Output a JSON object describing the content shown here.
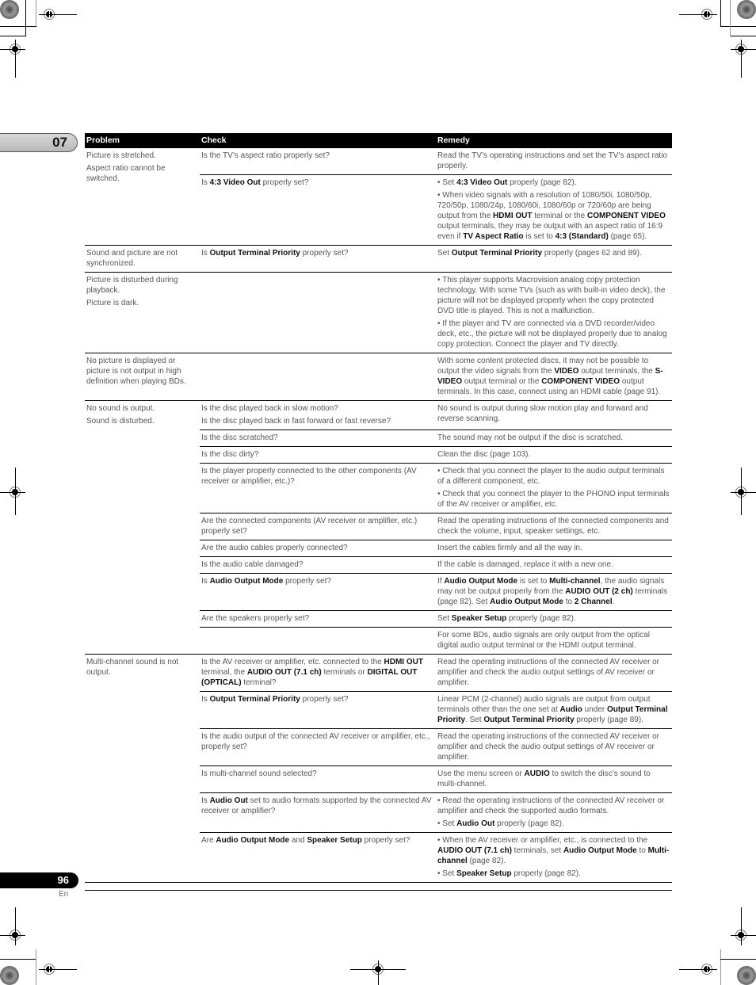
{
  "chapter": "07",
  "page_number": "96",
  "language": "En",
  "table": {
    "headers": {
      "problem": "Problem",
      "check": "Check",
      "remedy": "Remedy"
    },
    "groups": [
      {
        "problem": [
          "Picture is stretched.",
          "Aspect ratio cannot be switched."
        ],
        "rows": [
          {
            "check": [
              "Is the TV’s aspect ratio properly set?"
            ],
            "remedy": [
              "Read the TV’s operating instructions and set the TV’s aspect ratio properly."
            ]
          },
          {
            "check": [
              "Is <b>4:3 Video Out</b> properly set?"
            ],
            "remedy": [
              "• Set <b>4:3 Video Out</b> properly (page 82).",
              "• When video signals with a resolution of 1080/50i, 1080/50p, 720/50p, 1080/24p, 1080/60i, 1080/60p or 720/60p are being output from the <b>HDMI OUT</b> terminal or the <b>COMPONENT VIDEO</b> output terminals, they may be output with an aspect ratio of 16:9 even if <b>TV Aspect Ratio</b> is set to <b>4:3 (Standard)</b> (page 65)."
            ]
          }
        ]
      },
      {
        "problem": [
          "Sound and picture are not synchronized."
        ],
        "rows": [
          {
            "check": [
              "Is <b>Output Terminal Priority</b> properly set?"
            ],
            "remedy": [
              "Set <b>Output Terminal Priority</b> properly (pages 62 and 89)."
            ]
          }
        ]
      },
      {
        "problem": [
          "Picture is disturbed during playback.",
          "Picture is dark."
        ],
        "rows": [
          {
            "check": [],
            "remedy": [
              "• This player supports Macrovision analog copy protection technology. With some TVs (such as with built-in video deck), the picture will not be displayed properly when the copy protected DVD title is played. This is not a malfunction.",
              "• If the player and TV are connected via a DVD recorder/video deck, etc., the picture will not be displayed properly due to analog copy protection. Connect the player and TV directly."
            ]
          }
        ]
      },
      {
        "problem": [
          "No picture is displayed or picture is not output in high definition when playing BDs."
        ],
        "rows": [
          {
            "check": [],
            "remedy": [
              "With some content protected discs, it may not be possible to output the video signals from the <b>VIDEO</b> output terminals, the <b>S-VIDEO</b> output terminal or the <b>COMPONENT VIDEO</b> output terminals. In this case, connect using an HDMI cable (page 91)."
            ]
          }
        ]
      },
      {
        "problem": [
          "No sound is output.",
          "Sound is disturbed."
        ],
        "rows": [
          {
            "check": [
              "Is the disc played back in slow motion?",
              "Is the disc played back in fast forward or fast reverse?"
            ],
            "remedy": [
              "No sound is output during slow motion play and forward and reverse scanning."
            ]
          },
          {
            "check": [
              "Is the disc scratched?"
            ],
            "remedy": [
              "The sound may not be output if the disc is scratched."
            ]
          },
          {
            "check": [
              "Is the disc dirty?"
            ],
            "remedy": [
              "Clean the disc (page 103)."
            ]
          },
          {
            "check": [
              "Is the player properly connected to the other components (AV receiver or amplifier, etc.)?"
            ],
            "remedy": [
              "• Check that you connect the player to the audio output terminals of a different component, etc.",
              "• Check that you connect the player to the PHONO input terminals of the AV receiver or amplifier, etc."
            ]
          },
          {
            "check": [
              "Are the connected components (AV receiver or amplifier, etc.) properly set?"
            ],
            "remedy": [
              "Read the operating instructions of the connected components and check the volume, input, speaker settings, etc."
            ]
          },
          {
            "check": [
              "Are the audio cables properly connected?"
            ],
            "remedy": [
              "Insert the cables firmly and all the way in."
            ]
          },
          {
            "check": [
              "Is the audio cable damaged?"
            ],
            "remedy": [
              "If the cable is damaged, replace it with a new one."
            ]
          },
          {
            "check": [
              "Is <b>Audio Output Mode</b> properly set?"
            ],
            "remedy": [
              "If <b>Audio Output Mode</b> is set to <b>Multi-channel</b>, the audio signals may not be output properly from the <b>AUDIO OUT (2 ch)</b> terminals (page 82). Set <b>Audio Output Mode</b> to <b>2 Channel</b>."
            ]
          },
          {
            "check": [
              "Are the speakers properly set?"
            ],
            "remedy": [
              "Set <b>Speaker Setup</b> properly (page 82)."
            ]
          },
          {
            "check": [],
            "remedy": [
              "For some BDs, audio signals are only output from the optical digital audio output terminal or the HDMI output terminal."
            ]
          }
        ]
      },
      {
        "problem": [
          "Multi-channel sound is not output."
        ],
        "rows": [
          {
            "check": [
              "Is the AV receiver or amplifier, etc. connected to the <b>HDMI OUT</b> terminal, the <b>AUDIO OUT (7.1 ch)</b> terminals or <b>DIGITAL OUT (OPTICAL)</b> terminal?"
            ],
            "remedy": [
              "Read the operating instructions of the connected AV receiver or amplifier and check the audio output settings of AV receiver or amplifier."
            ]
          },
          {
            "check": [
              "Is <b>Output Terminal Priority</b> properly set?"
            ],
            "remedy": [
              "Linear PCM (2-channel) audio signals are output from output terminals other than the one set at <b>Audio</b> under <b>Output Terminal Priority</b>. Set <b>Output Terminal Priority</b> properly (page 89)."
            ]
          },
          {
            "check": [
              "Is the audio output of the connected AV receiver or amplifier, etc., properly set?"
            ],
            "remedy": [
              "Read the operating instructions of the connected AV receiver or amplifier and check the audio output settings of AV receiver or amplifier."
            ]
          },
          {
            "check": [
              "Is multi-channel sound selected?"
            ],
            "remedy": [
              "Use the menu screen or <b>AUDIO</b> to switch the disc’s sound to multi-channel."
            ]
          },
          {
            "check": [
              "Is <b>Audio Out</b> set to audio formats supported by the connected AV receiver or amplifier?"
            ],
            "remedy": [
              "• Read the operating instructions of the connected AV receiver or amplifier and check the supported audio formats.",
              "• Set <b>Audio Out</b> properly (page 82)."
            ]
          },
          {
            "check": [
              "Are <b>Audio Output Mode</b> and <b>Speaker Setup</b> properly set?"
            ],
            "remedy": [
              "• When the AV receiver or amplifier, etc., is connected to the <b>AUDIO OUT (7.1 ch)</b> terminals, set <b>Audio Output Mode</b> to <b>Multi-channel</b> (page 82).",
              "• Set <b>Speaker Setup</b> properly (page 82)."
            ]
          }
        ]
      }
    ]
  }
}
